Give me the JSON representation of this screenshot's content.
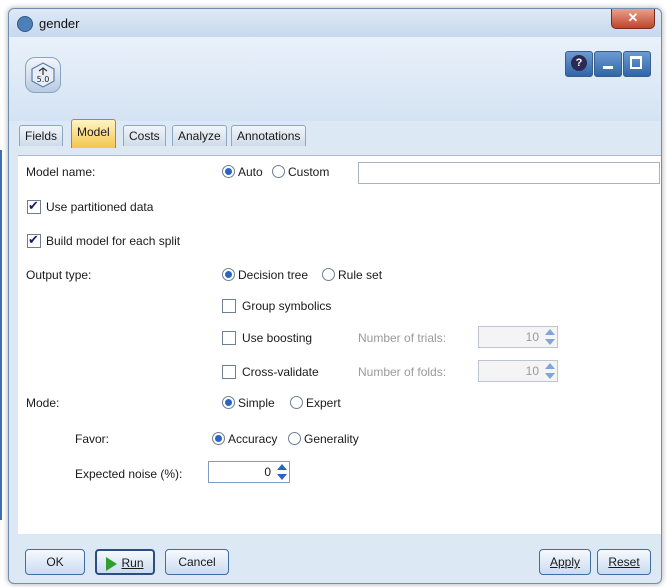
{
  "window": {
    "title": "gender"
  },
  "header": {
    "help_glyph": "?"
  },
  "tabs": [
    "Fields",
    "Model",
    "Costs",
    "Analyze",
    "Annotations"
  ],
  "model_name": {
    "label": "Model name:",
    "options": [
      "Auto",
      "Custom"
    ],
    "selected": "Auto",
    "value": ""
  },
  "use_partitioned_data": {
    "label": "Use partitioned data",
    "checked": true
  },
  "build_model_each_split": {
    "label": "Build model for each split",
    "checked": true
  },
  "output_type": {
    "label": "Output type:",
    "options": [
      "Decision tree",
      "Rule set"
    ],
    "selected": "Decision tree"
  },
  "group_symbolics": {
    "label": "Group symbolics",
    "checked": false
  },
  "use_boosting": {
    "label": "Use boosting",
    "checked": false,
    "trials_label": "Number of trials:",
    "trials_value": "10"
  },
  "cross_validate": {
    "label": "Cross-validate",
    "checked": false,
    "folds_label": "Number of folds:",
    "folds_value": "10"
  },
  "mode": {
    "label": "Mode:",
    "options": [
      "Simple",
      "Expert"
    ],
    "selected": "Simple"
  },
  "favor": {
    "label": "Favor:",
    "options": [
      "Accuracy",
      "Generality"
    ],
    "selected": "Accuracy"
  },
  "expected_noise": {
    "label": "Expected noise (%):",
    "value": "0"
  },
  "footer": {
    "ok": "OK",
    "run": "Run",
    "cancel": "Cancel",
    "apply": "Apply",
    "reset": "Reset"
  },
  "colors": {
    "active_tab": "#f4c64c",
    "accent": "#2b63c7",
    "close": "#c0442a"
  },
  "icons": [
    "model-icon",
    "help-icon",
    "minimize-icon",
    "maximize-icon",
    "close-icon",
    "play-icon"
  ]
}
